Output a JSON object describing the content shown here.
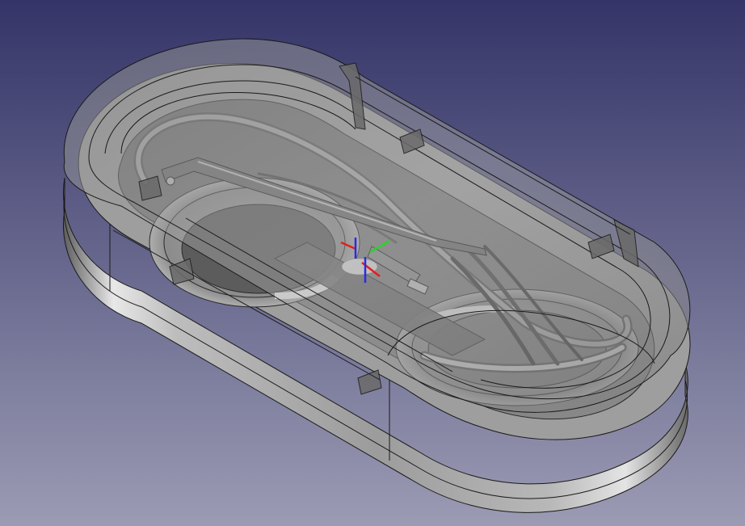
{
  "app": {
    "view": "3d-viewport",
    "projection": "isometric"
  },
  "colors": {
    "background_top": "#343468",
    "background_bottom": "#9b9bb4",
    "shell_light": "#e6e6e6",
    "shell_mid": "#9a9a9a",
    "shell_dark": "#5a5a5a",
    "edge": "#1a1a1a",
    "cable": "#8c8c8c",
    "axis_x": "#e0201c",
    "axis_y": "#2fd02f",
    "axis_z": "#2a2ae6"
  },
  "model": {
    "parts": [
      "case-bottom",
      "case-lid",
      "left-spool",
      "right-spool",
      "cable-coil",
      "glasses-arm",
      "center-connector"
    ]
  },
  "axis_cross": {
    "axes": [
      "x-axis",
      "y-axis",
      "z-axis"
    ]
  }
}
